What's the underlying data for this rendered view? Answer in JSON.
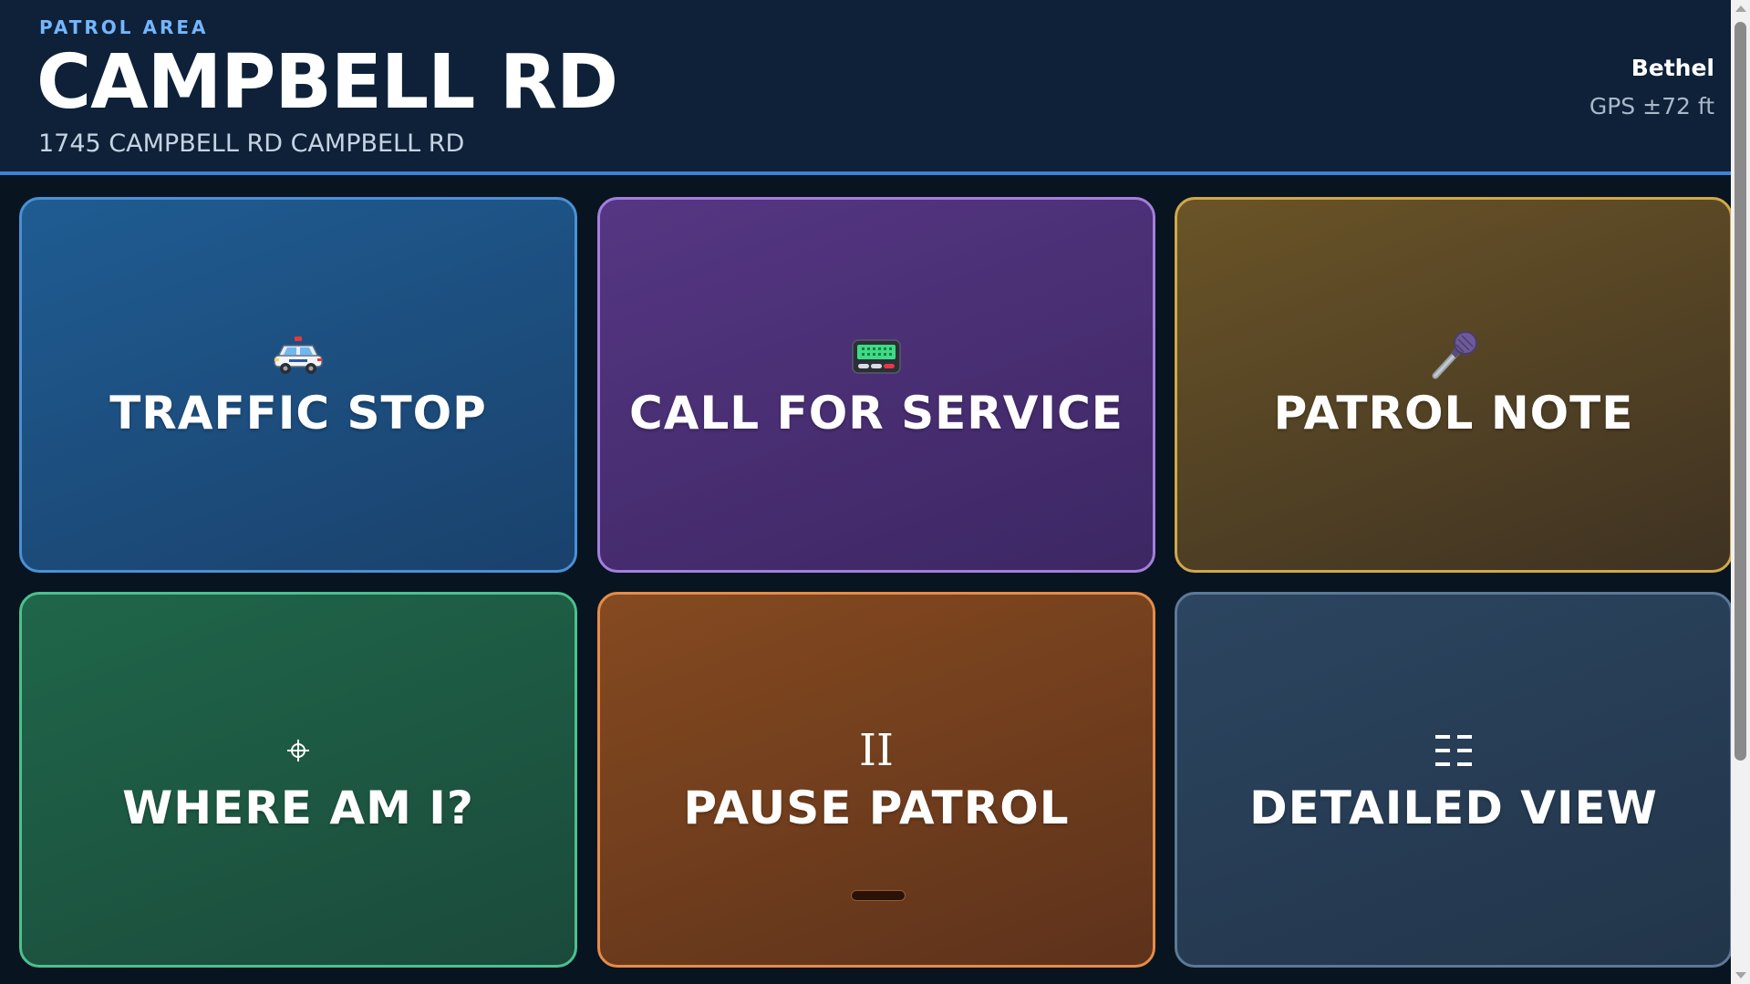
{
  "header": {
    "eyebrow": "PATROL AREA",
    "title": "CAMPBELL RD",
    "address": "1745 CAMPBELL RD CAMPBELL RD",
    "location_name": "Bethel",
    "gps_accuracy": "GPS ±72 ft"
  },
  "tiles": [
    {
      "label": "TRAFFIC STOP",
      "icon": "police-car-icon",
      "color": "#1f5c92"
    },
    {
      "label": "CALL FOR SERVICE",
      "icon": "pager-icon",
      "color": "#553683"
    },
    {
      "label": "PATROL NOTE",
      "icon": "microphone-icon",
      "color": "#6a5427"
    },
    {
      "label": "WHERE AM I?",
      "icon": "crosshair-icon",
      "glyph": "⌖",
      "color": "#1f664a"
    },
    {
      "label": "PAUSE PATROL",
      "icon": "pause-icon",
      "glyph": "II",
      "color": "#854a20"
    },
    {
      "label": "DETAILED VIEW",
      "icon": "list-icon",
      "color": "#2c4560"
    }
  ],
  "colors": {
    "header_bg": "#0e2139",
    "header_rule": "#3d82d6",
    "eyebrow": "#74b6ff",
    "page_bg": "#08141f"
  }
}
